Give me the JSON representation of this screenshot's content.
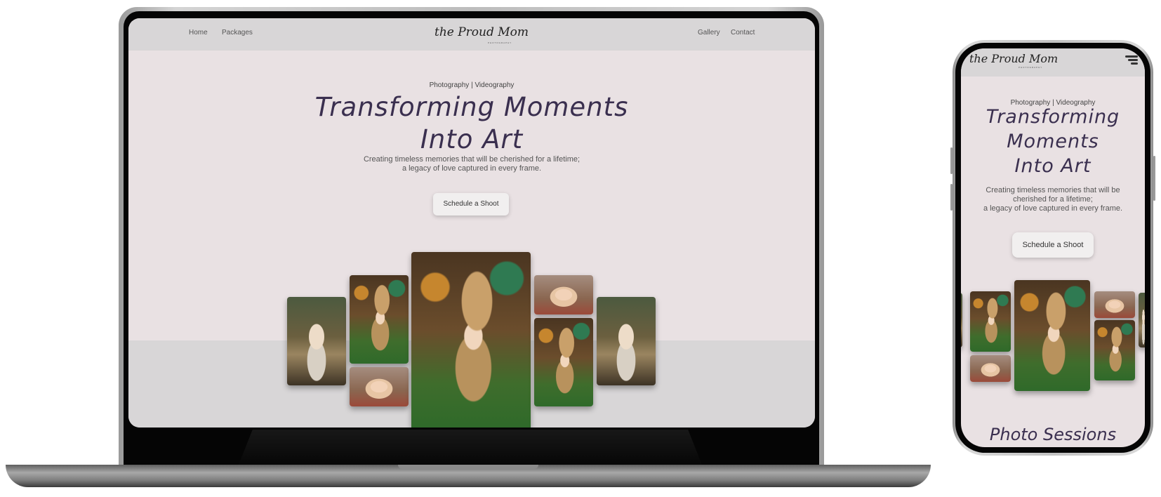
{
  "laptop_site": {
    "nav": {
      "left_links": [
        "Home",
        "Packages"
      ],
      "right_links": [
        "Gallery",
        "Contact"
      ],
      "logo": "the Proud Mom",
      "logo_sub": "PHOTOGRAPHY"
    },
    "hero": {
      "eyebrow": "Photography | Videography",
      "title_line1": "Transforming Moments",
      "title_line2": "Into Art",
      "subtitle_line1": "Creating timeless memories that will be cherished for a lifetime;",
      "subtitle_line2": "a legacy of love captured in every frame.",
      "cta": "Schedule a Shoot"
    }
  },
  "phone_site": {
    "nav": {
      "logo": "the Proud Mom",
      "logo_sub": "PHOTOGRAPHY",
      "menu_icon": "hamburger-menu-icon"
    },
    "hero": {
      "eyebrow": "Photography | Videography",
      "title_line1": "Transforming",
      "title_line2": "Moments",
      "title_line3": "Into Art",
      "subtitle_line1": "Creating timeless memories that will be",
      "subtitle_line2": "cherished for a lifetime;",
      "subtitle_line3": "a legacy of love captured in every frame.",
      "cta": "Schedule a Shoot"
    },
    "next_section_heading": "Photo Sessions"
  },
  "colors": {
    "hero_bg": "#e9e1e3",
    "nav_bg": "#d8d6d7",
    "title_color": "#3a2f4f"
  }
}
